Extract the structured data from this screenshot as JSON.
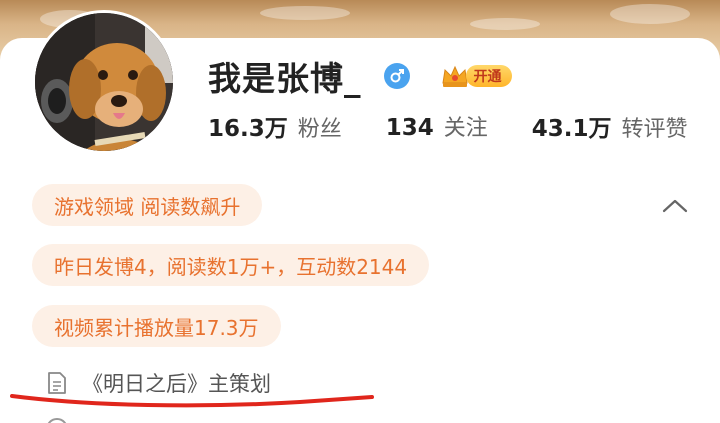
{
  "profile": {
    "name": "我是张博_",
    "gender_icon": "male-gender-icon",
    "vip_label": "开通",
    "avatar_icon": "golden-retriever-avatar"
  },
  "stats": [
    {
      "num": "16.3万",
      "label": "粉丝"
    },
    {
      "num": "134",
      "label": "关注"
    },
    {
      "num": "43.1万",
      "label": "转评赞"
    }
  ],
  "tags": {
    "domain": "游戏领域 阅读数飙升",
    "yesterday": "昨日发博4，阅读数1万+，互动数2144",
    "video": "视频累计播放量17.3万"
  },
  "bio": {
    "doc_text": "《明日之后》主策划"
  },
  "colors": {
    "tag_text": "#e8722f",
    "tag_bg": "#fdf0e6",
    "gender_blue": "#4aa3ef",
    "annotation_red": "#e0261c"
  }
}
